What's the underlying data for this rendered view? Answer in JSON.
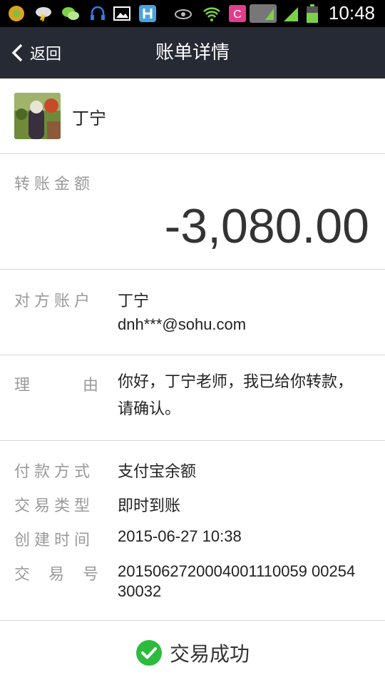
{
  "status_bar": {
    "time": "10:48"
  },
  "nav": {
    "back_label": "返回",
    "title": "账单详情"
  },
  "payee": {
    "name": "丁宁"
  },
  "amount": {
    "label": "转账金额",
    "value": "-3,080.00"
  },
  "account": {
    "label": "对方账户",
    "name": "丁宁",
    "email": "dnh***@sohu.com"
  },
  "reason": {
    "label_chars": [
      "理",
      "由"
    ],
    "text": "你好，丁宁老师，我已给你转款，请确认。"
  },
  "details": {
    "payment_method": {
      "label": "付款方式",
      "value": "支付宝余额"
    },
    "trade_type": {
      "label": "交易类型",
      "value": "即时到账"
    },
    "created_time": {
      "label": "创建时间",
      "value": "2015-06-27 10:38"
    },
    "trade_no": {
      "label_chars": [
        "交",
        "易",
        "号"
      ],
      "value": "2015062720004001110059 0025430032"
    }
  },
  "footer": {
    "status": "交易成功"
  },
  "colors": {
    "nav_bg": "#262a35",
    "success": "#2dbb3e",
    "label_gray": "#9a9a9a"
  }
}
